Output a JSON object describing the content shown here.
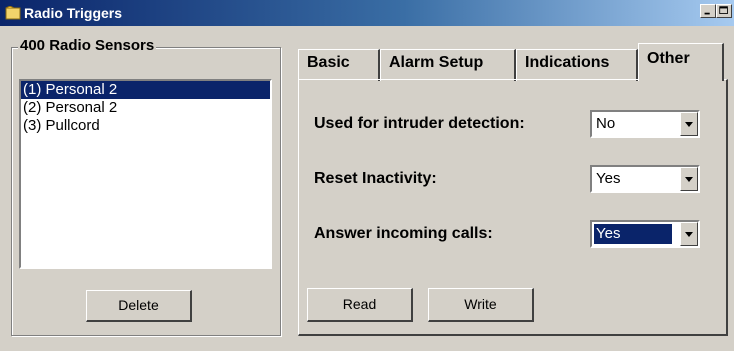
{
  "window": {
    "title": "Radio Triggers"
  },
  "sensors": {
    "group_title": "400 Radio Sensors",
    "items": [
      {
        "label": "(1) Personal 2",
        "selected": true
      },
      {
        "label": "(2) Personal 2",
        "selected": false
      },
      {
        "label": "(3) Pullcord",
        "selected": false
      }
    ],
    "delete_label": "Delete"
  },
  "tabs": [
    {
      "label": "Basic",
      "active": false
    },
    {
      "label": "Alarm Setup",
      "active": false
    },
    {
      "label": "Indications",
      "active": false
    },
    {
      "label": "Other",
      "active": true
    }
  ],
  "other": {
    "fields": [
      {
        "label": "Used for intruder detection:",
        "value": "No"
      },
      {
        "label": "Reset Inactivity:",
        "value": "Yes"
      },
      {
        "label": "Answer incoming calls:",
        "value": "Yes"
      }
    ],
    "read_label": "Read",
    "write_label": "Write"
  },
  "colors": {
    "selection": "#0a246a",
    "face": "#d4d0c8"
  }
}
